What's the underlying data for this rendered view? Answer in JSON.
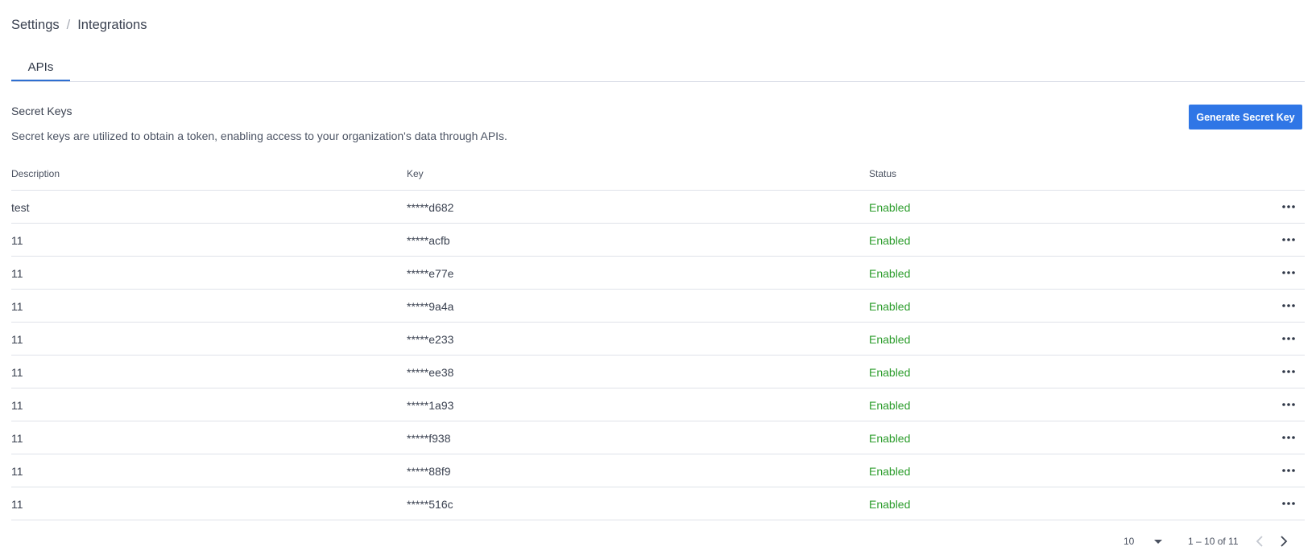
{
  "breadcrumb": {
    "items": [
      "Settings",
      "Integrations"
    ],
    "separator": "/"
  },
  "tabs": [
    {
      "label": "APIs",
      "active": true
    }
  ],
  "section": {
    "title": "Secret Keys",
    "description": "Secret keys are utilized to obtain a token, enabling access to your organization's data through APIs.",
    "generate_button_label": "Generate Secret Key"
  },
  "table": {
    "headers": {
      "description": "Description",
      "key": "Key",
      "status": "Status"
    },
    "rows": [
      {
        "description": "test",
        "key": "*****d682",
        "status": "Enabled"
      },
      {
        "description": "11",
        "key": "*****acfb",
        "status": "Enabled"
      },
      {
        "description": "11",
        "key": "*****e77e",
        "status": "Enabled"
      },
      {
        "description": "11",
        "key": "*****9a4a",
        "status": "Enabled"
      },
      {
        "description": "11",
        "key": "*****e233",
        "status": "Enabled"
      },
      {
        "description": "11",
        "key": "*****ee38",
        "status": "Enabled"
      },
      {
        "description": "11",
        "key": "*****1a93",
        "status": "Enabled"
      },
      {
        "description": "11",
        "key": "*****f938",
        "status": "Enabled"
      },
      {
        "description": "11",
        "key": "*****88f9",
        "status": "Enabled"
      },
      {
        "description": "11",
        "key": "*****516c",
        "status": "Enabled"
      }
    ],
    "row_action_icon": "more-horizontal-icon"
  },
  "pagination": {
    "page_size": "10",
    "range_text": "1 – 10 of 11",
    "prev_icon": "chevron-left-icon",
    "next_icon": "chevron-right-icon"
  },
  "colors": {
    "accent": "#2f76e6",
    "tab_underline": "#2e6fd1",
    "status_enabled": "#2b9c2b",
    "divider": "#dfe2e9"
  }
}
